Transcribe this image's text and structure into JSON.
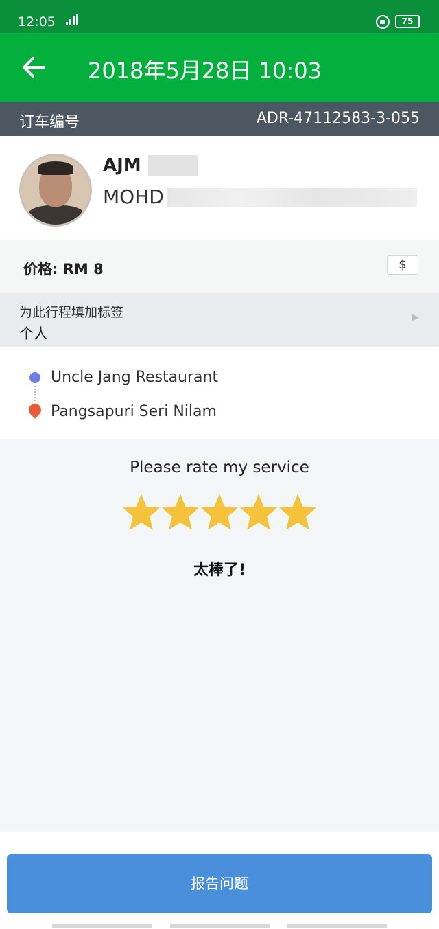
{
  "status_bar": {
    "time": "12:05",
    "signal": "⸽⸽▏▎",
    "battery": "75"
  },
  "app_bar": {
    "title": "2018年5月28日 10:03"
  },
  "booking": {
    "label": "订车编号",
    "id": "ADR-47112583-3-055"
  },
  "driver": {
    "name": "AJM",
    "plate": "MOHD"
  },
  "price": {
    "label": "价格: RM 8",
    "payment_icon": "$"
  },
  "tag": {
    "title": "为此行程填加标签",
    "value": "个人"
  },
  "route": {
    "pickup": "Uncle Jang Restaurant",
    "dropoff": "Pangsapuri Seri Nilam"
  },
  "rating": {
    "prompt": "Please rate my service",
    "stars": 5,
    "max_stars": 5,
    "result_text": "太棒了!"
  },
  "footer": {
    "report_button": "报告问题"
  },
  "colors": {
    "status_bar": "#0a8f3a",
    "app_bar": "#04b03d",
    "booking_bar": "#4c5762",
    "star": "#f5c33b",
    "report_button": "#4a8fdc",
    "pickup_dot": "#6e7de6",
    "dropoff_pin": "#ea5a36"
  }
}
